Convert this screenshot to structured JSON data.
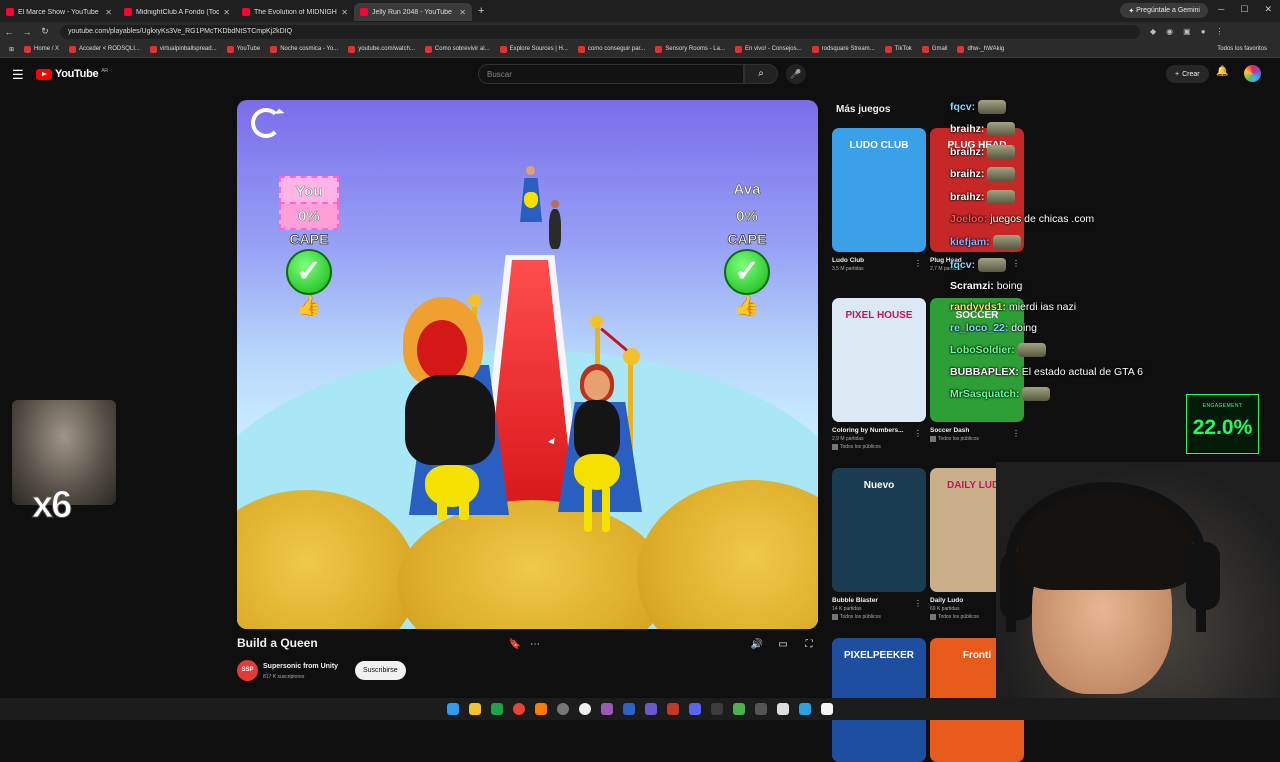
{
  "browser": {
    "tabs": [
      {
        "title": "El Marce Show - YouTube",
        "active": false
      },
      {
        "title": "MidnightClub A Fondo (Todo l",
        "active": false
      },
      {
        "title": "The Evolution of MIDNIGHT CL",
        "active": false
      },
      {
        "title": "Jelly Run 2048 - YouTube",
        "active": true
      }
    ],
    "gemini_label": "Pregúntale a Gemini",
    "url": "youtube.com/playables/UgkxyKs3Ve_RG1PMcTKDbdNtSTCmpKj2kDIQ",
    "bookmarks": [
      "Home / X",
      "Acceder < RODSQLI...",
      "virtualpinballspread...",
      "YouTube",
      "Noche cosmica - Yo...",
      "youtube.com/watch...",
      "Como sobrevivir al...",
      "Explore Sources | H...",
      "como conseguir par...",
      "Sensory Rooms - La...",
      "En vivo! - Consejos...",
      "rodsquare Stream...",
      "TikTok",
      "Gmail",
      "dhw-_hWAkig"
    ],
    "bookmarks_right": "Todos los favoritos"
  },
  "youtube": {
    "logo_text": "YouTube",
    "logo_region": "AR",
    "search_placeholder": "Buscar",
    "create_label": "Crear"
  },
  "game": {
    "player_label": "You",
    "player_pct": "0%",
    "opponent_label": "Ava",
    "opponent_pct": "0%",
    "category": "CAPE",
    "title": "Build a Queen",
    "channel_name": "Supersonic from Unity",
    "channel_avatar_text": "SSP",
    "channel_subs": "817 K suscriptores",
    "subscribe_label": "Suscribirse"
  },
  "more_games": {
    "heading": "Más juegos",
    "cards": [
      {
        "title": "Ludo Club",
        "meta": "3,5 M partidas",
        "badge": "",
        "thumb_text": "LUDO CLUB",
        "bg": "#3aa0e8"
      },
      {
        "title": "Plug Head",
        "meta": "2,7 M partidas",
        "badge": "",
        "thumb_text": "PLUG HEAD",
        "bg": "#c62828"
      },
      {
        "title": "Coloring by Numbers...",
        "meta": "2,9 M partidas",
        "badge": "Todos los públicos",
        "thumb_text": "PIXEL HOUSE",
        "bg": "#dbe9f5"
      },
      {
        "title": "Soccer Dash",
        "meta": "",
        "badge": "Todos los públicos",
        "thumb_text": "SOCCER",
        "bg": "#2e9e36"
      },
      {
        "title": "Bubble Blaster",
        "meta": "14 K partidas",
        "badge": "Todos los públicos",
        "thumb_text": "Nuevo",
        "bg": "#1a3d52"
      },
      {
        "title": "Daily Ludo",
        "meta": "69 K partidas",
        "badge": "Todos los públicos",
        "thumb_text": "DAILY LUDO",
        "bg": "#c9b08a"
      },
      {
        "title": "",
        "meta": "",
        "badge": "",
        "thumb_text": "PIXELPEEKER",
        "bg": "#1e4ea0"
      },
      {
        "title": "",
        "meta": "",
        "badge": "",
        "thumb_text": "Frontl",
        "bg": "#e65a1c"
      }
    ]
  },
  "chat": [
    {
      "user": "fqcv:",
      "msg": "",
      "color": "#7fd9ff",
      "emote": true
    },
    {
      "user": "braihz:",
      "msg": "",
      "color": "#ffffff",
      "emote": true
    },
    {
      "user": "braihz:",
      "msg": "",
      "color": "#ffffff",
      "emote": true
    },
    {
      "user": "braihz:",
      "msg": "",
      "color": "#ffffff",
      "emote": true
    },
    {
      "user": "braihz:",
      "msg": "",
      "color": "#ffffff",
      "emote": true
    },
    {
      "user": "Joeloo:",
      "msg": "juegos de chicas .com",
      "color": "#ff4d4d",
      "emote": false
    },
    {
      "user": "kiefjam:",
      "msg": "",
      "color": "#8fb2ff",
      "emote": true
    },
    {
      "user": "fqcv:",
      "msg": "",
      "color": "#7fd9ff",
      "emote": true
    },
    {
      "user": "Scramzi:",
      "msg": "boing",
      "color": "#ffffff",
      "emote": false
    },
    {
      "user": "randyyds1:",
      "msg": "mierdi ias nazi",
      "color": "#f2e94e",
      "emote": false
    },
    {
      "user": "re_loco_22:",
      "msg": "doing",
      "color": "#7fd9ff",
      "emote": false
    },
    {
      "user": "LoboSoldier:",
      "msg": "",
      "color": "#63ff9b",
      "emote": true
    },
    {
      "user": "BUBBAPLEX:",
      "msg": "El estado actual de GTA 6",
      "color": "#ffffff",
      "emote": false
    },
    {
      "user": "MrSasquatch:",
      "msg": "",
      "color": "#63ff9b",
      "emote": true
    }
  ],
  "overlay": {
    "engagement_label": "ENGAGEMENT",
    "engagement_value": "22.0%",
    "multiplier": "x6"
  }
}
